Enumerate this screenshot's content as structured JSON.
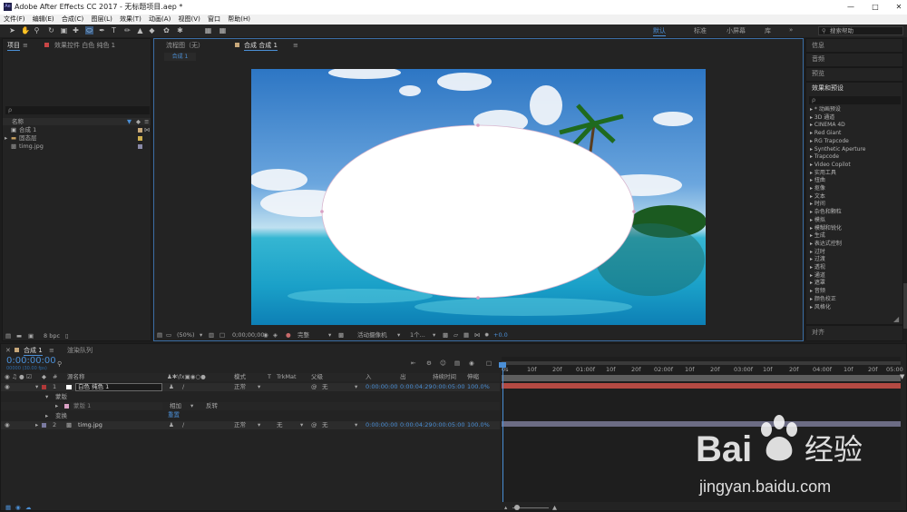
{
  "window": {
    "title": "Adobe After Effects CC 2017 - 无标题项目.aep *",
    "app_badge": "Ae"
  },
  "menu": [
    "文件(F)",
    "编辑(E)",
    "合成(C)",
    "图层(L)",
    "效果(T)",
    "动画(A)",
    "视图(V)",
    "窗口",
    "帮助(H)"
  ],
  "workspaces": {
    "default": "默认",
    "standard": "标准",
    "small": "小屏幕",
    "library": "库",
    "search_placeholder": "搜索帮助"
  },
  "project_panel": {
    "tab": "项目",
    "effects_tab": "效果控件 白色 纯色 1",
    "search_placeholder": "ρ",
    "col_name": "名称",
    "items": [
      {
        "name": "合成 1",
        "type": "comp",
        "color": "#c8a87a"
      },
      {
        "name": "固态层",
        "type": "folder",
        "color": "#d0b050"
      },
      {
        "name": "timg.jpg",
        "type": "image",
        "color": "#8a8aa8"
      }
    ],
    "bpc": "8 bpc"
  },
  "viewer": {
    "tab_flow": "流程图（无）",
    "tab_comp": "合成 合成 1",
    "sub_tab": "合成 1",
    "zoom": "(50%)",
    "timecode": "0;00;00;00",
    "quality": "完整",
    "camera": "活动摄像机",
    "views": "1个...",
    "exposure": "+0.0"
  },
  "right_panel": {
    "info": "信息",
    "audio": "音频",
    "preview": "预览",
    "effects_title": "效果和预设",
    "search_placeholder": "ρ",
    "items": [
      "* 动画预设",
      "3D 通道",
      "CINEMA 4D",
      "Red Giant",
      "RG Trapcode",
      "Synthetic Aperture",
      "Trapcode",
      "Video Copilot",
      "实用工具",
      "扭曲",
      "抠像",
      "文本",
      "时间",
      "杂色和颗粒",
      "模拟",
      "模糊和锐化",
      "生成",
      "表达式控制",
      "过时",
      "过渡",
      "透视",
      "通道",
      "遮罩",
      "音频",
      "颜色校正",
      "风格化"
    ],
    "align": "对齐"
  },
  "timeline": {
    "tab_comp": "合成 1",
    "tab_render": "渲染队列",
    "timecode": "0:00:00:00",
    "frames": "00000 (30.00 fps)",
    "col_source": "源名称",
    "col_mode": "模式",
    "col_t": "T",
    "col_trkmat": "TrkMat",
    "col_parent": "父级",
    "col_in": "入",
    "col_out": "出",
    "col_duration": "持续时间",
    "col_stretch": "伸缩",
    "layers": [
      {
        "index": "1",
        "name": "白色 纯色 1",
        "mode": "正常",
        "trkmat": "",
        "parent": "无",
        "in": "0:00:00:00",
        "out": "0:00:04:29",
        "duration": "0:00:05:00",
        "stretch": "100.0%",
        "color": "#c84646",
        "label_color": "#b03838"
      },
      {
        "index": "2",
        "name": "timg.jpg",
        "mode": "正常",
        "trkmat": "无",
        "parent": "无",
        "in": "0:00:00:00",
        "out": "0:00:04:29",
        "duration": "0:00:05:00",
        "stretch": "100.0%",
        "color": "#9090b0",
        "label_color": "#7a7aa0"
      }
    ],
    "mask_group": "蒙版",
    "mask_item": "蒙版 1",
    "mask_mode": "相加",
    "mask_invert": "反转",
    "mask_reset": "重置",
    "transform": "变换",
    "ruler": [
      "0s",
      "10f",
      "20f",
      "01:00f",
      "10f",
      "20f",
      "02:00f",
      "10f",
      "20f",
      "03:00f",
      "10f",
      "20f",
      "04:00f",
      "10f",
      "20f",
      "05:00"
    ]
  },
  "watermark": {
    "brand": "Bai",
    "brand2": "经验",
    "url": "jingyan.baidu.com"
  },
  "colors": {
    "accent": "#4b8fd6",
    "panel": "#232323",
    "layer1": "#c84646",
    "layer2": "#8a8aa8"
  }
}
